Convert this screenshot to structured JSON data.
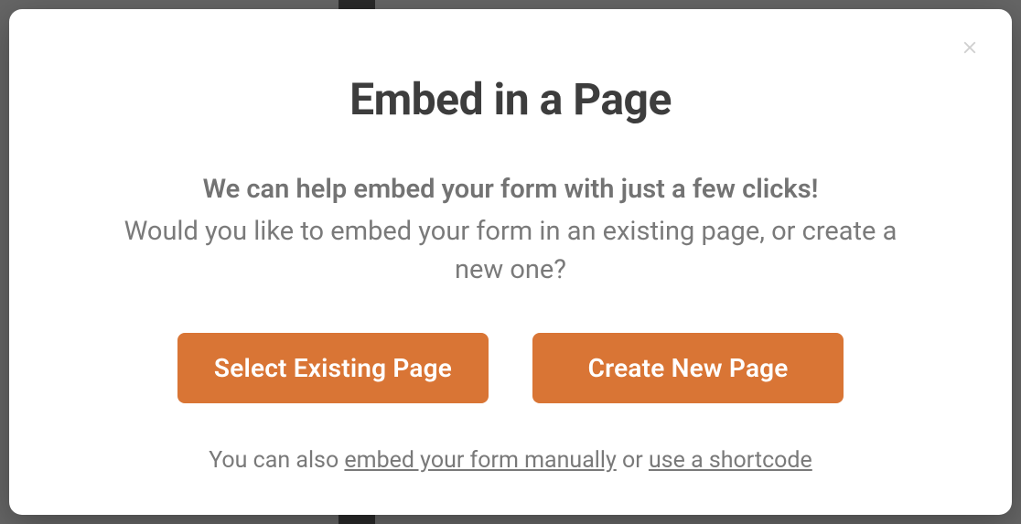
{
  "modal": {
    "title": "Embed in a Page",
    "lead": "We can help embed your form with just a few clicks!",
    "sub": "Would you like to embed your form in an existing page, or create a new one?",
    "buttons": {
      "existing": "Select Existing Page",
      "new": "Create New Page"
    },
    "footer": {
      "prefix": "You can also ",
      "link1": "embed your form manually",
      "middle": " or ",
      "link2": "use a shortcode"
    }
  }
}
